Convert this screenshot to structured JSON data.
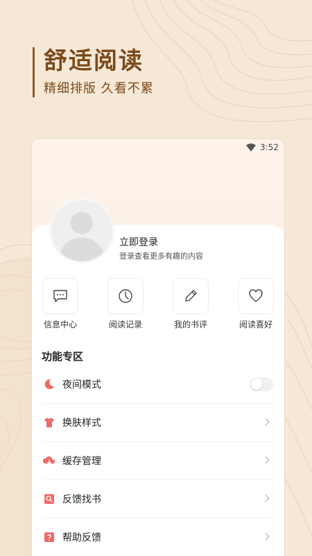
{
  "promo": {
    "title": "舒适阅读",
    "subtitle": "精细排版 久看不累"
  },
  "status_bar": {
    "time": "3:52",
    "icons": [
      "wifi-icon"
    ]
  },
  "profile": {
    "login_title": "立即登录",
    "login_subtitle": "登录查看更多有趣的内容",
    "avatar_icon": "default-avatar-icon"
  },
  "quick_actions": [
    {
      "label": "信息中心",
      "icon": "message-icon"
    },
    {
      "label": "阅读记录",
      "icon": "clock-icon"
    },
    {
      "label": "我的书评",
      "icon": "pencil-icon"
    },
    {
      "label": "阅读喜好",
      "icon": "heart-icon"
    }
  ],
  "section": {
    "title": "功能专区"
  },
  "menu": [
    {
      "label": "夜间模式",
      "icon": "moon-icon",
      "control": "toggle",
      "toggle_on": false
    },
    {
      "label": "换肤样式",
      "icon": "tshirt-icon",
      "control": "chevron"
    },
    {
      "label": "缓存管理",
      "icon": "cloud-download-icon",
      "control": "chevron"
    },
    {
      "label": "反馈找书",
      "icon": "book-icon",
      "control": "chevron"
    },
    {
      "label": "帮助反馈",
      "icon": "help-icon",
      "control": "chevron"
    }
  ],
  "colors": {
    "background": "#f6e8d6",
    "promo_text": "#7a4a1c",
    "icon_accent": "#ee6a6a"
  }
}
